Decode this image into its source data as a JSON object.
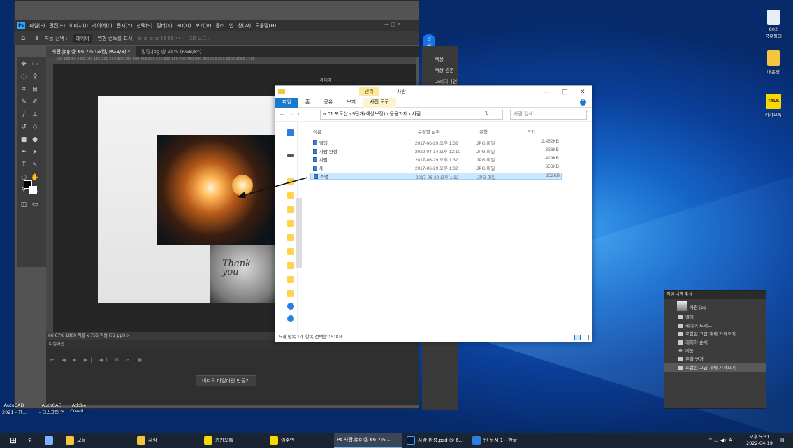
{
  "photoshop": {
    "menu": [
      "파일(F)",
      "편집(E)",
      "이미지(I)",
      "레이어(L)",
      "문자(Y)",
      "선택(S)",
      "필터(T)",
      "3D(D)",
      "보기(V)",
      "플러그인",
      "창(W)",
      "도움말(H)"
    ],
    "options": {
      "auto_select": "자동 선택 :",
      "layer": "레이어",
      "transform": "변형 컨트롤 표시",
      "mode3d": "3D 모드 :",
      "share": "공유"
    },
    "tabs": [
      "사람.jpg @ 66.7% (조명, RGB/8) *",
      "빌딩.jpg @ 25% (RGB/8*)"
    ],
    "ruler": "100 150 50 0 50 100 150 200 250 300 350 400 450 500 550 600 650 700 750 800 850 900 950 1000 1050 1100",
    "status": "66.67%   1000 픽셀 x 756 픽셀 (72 ppi)   >",
    "timeline_title": "타임라인",
    "timeline_button": "비디오 타임라인 만들기",
    "panels": {
      "color": "색상",
      "swatches": "색상 견본",
      "gradient": "그레이디언트",
      "layers": "레이어"
    },
    "shirt_text": "Thank\nyou"
  },
  "explorer": {
    "ribbon": {
      "manage": "관리",
      "title": "사람",
      "file": "파일",
      "home": "홈",
      "share": "공유",
      "view": "보기",
      "picture_tools": "사진 도구"
    },
    "breadcrumb": "« 01 포토샵 › 9단계(색상보정) › 응용과제 › 사람",
    "search_placeholder": "사람 검색",
    "columns": {
      "name": "이름",
      "date": "수정한 날짜",
      "type": "유형",
      "size": "크기"
    },
    "files": [
      {
        "name": "빌딩",
        "date": "2017-06-29 오후 1:32",
        "type": "JPG 파일",
        "size": "2,452KB"
      },
      {
        "name": "사람 완성",
        "date": "2022-04-14 오후 12:10",
        "type": "JPG 파일",
        "size": "326KB"
      },
      {
        "name": "사람",
        "date": "2017-06-29 오후 1:32",
        "type": "JPG 파일",
        "size": "419KB"
      },
      {
        "name": "새",
        "date": "2017-06-29 오후 1:32",
        "type": "JPG 파일",
        "size": "356KB"
      },
      {
        "name": "조명",
        "date": "2017-06-29 오후 1:32",
        "type": "JPG 파일",
        "size": "152KB"
      }
    ],
    "status": "5개 항목    1개 항목 선택함 151KB"
  },
  "history": {
    "tabs": "작업 내역   주석",
    "snapshot": "사람.jpg",
    "items": [
      "열기",
      "레이어 드래그",
      "포함된 고급 개체 가져오기",
      "레이어 순서",
      "이동",
      "혼합 변경",
      "포함된 고급 개체 가져오기"
    ]
  },
  "desktop": {
    "icons": [
      {
        "label": "802\n공유폴더"
      },
      {
        "label": "배은경"
      },
      {
        "label": "카카오톡"
      }
    ],
    "left_labels": [
      "AutoCAD\n2021 - 한...",
      "AutoCAD\n- 디스크립 언",
      "Adobe\nCreati..."
    ]
  },
  "taskbar": {
    "items": [
      "모듈",
      "사람",
      "카카오톡",
      "이수연",
      "Ps 사람.jpg @ 66.7% ...",
      "사람 완성.psd @ 6...",
      "빈 문서 1 - 한글"
    ],
    "ime": "A",
    "time": "오후 5:31",
    "date": "2022-04-19"
  }
}
